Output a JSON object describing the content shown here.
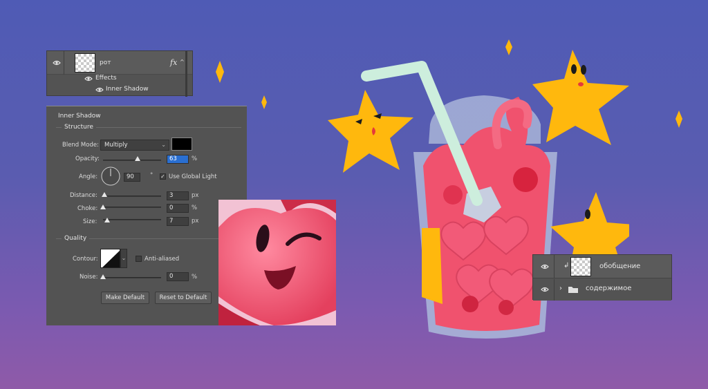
{
  "layers_top": {
    "layer_name": "рот",
    "fx_label": "fx",
    "effects_label": "Effects",
    "effect_item": "Inner Shadow"
  },
  "dialog": {
    "title": "Inner Shadow",
    "structure_heading": "Structure",
    "blend_mode_label": "Blend Mode:",
    "blend_mode_value": "Multiply",
    "shadow_color": "#000000",
    "opacity_label": "Opacity:",
    "opacity_value": "63",
    "percent": "%",
    "angle_label": "Angle:",
    "angle_value": "90",
    "degree": "°",
    "use_global_light_label": "Use Global Light",
    "use_global_light_checked": true,
    "distance_label": "Distance:",
    "distance_value": "3",
    "choke_label": "Choke:",
    "choke_value": "0",
    "size_label": "Size:",
    "size_value": "7",
    "px": "px",
    "quality_heading": "Quality",
    "contour_label": "Contour:",
    "anti_aliased_label": "Anti-aliased",
    "noise_label": "Noise:",
    "noise_value": "0",
    "make_default_label": "Make Default",
    "reset_default_label": "Reset to Default"
  },
  "layers_right": {
    "layer1_name": "обобщение",
    "layer2_name": "содержимое"
  },
  "colors": {
    "panel_bg": "#535353",
    "star_yellow": "#ffb80d",
    "drink_pink": "#f0526e",
    "cup_outline": "#a8b4d8",
    "straw": "#cdeedd"
  }
}
